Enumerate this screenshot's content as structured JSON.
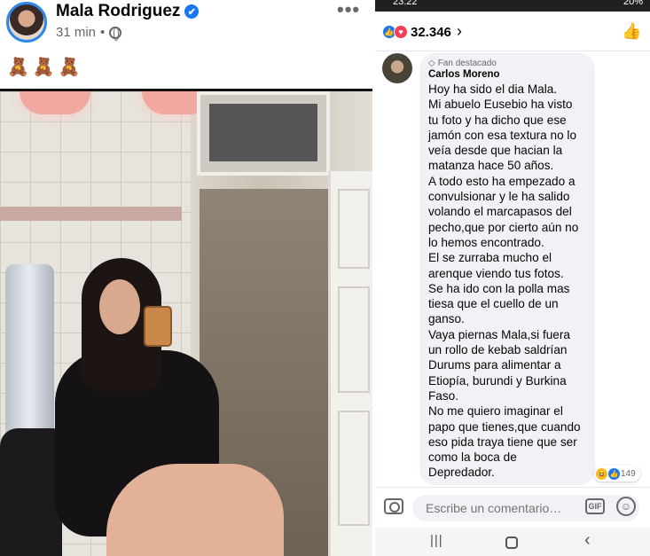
{
  "post": {
    "author": "Mala Rodriguez",
    "time": "31 min",
    "separator": "•",
    "more_label": "•••",
    "emojis": [
      "🧸",
      "🧸",
      "🧸"
    ],
    "verified_glyph": "✔"
  },
  "status_bar": {
    "time": "23:22",
    "battery": "20%"
  },
  "reactions": {
    "count": "32.346",
    "chevron": "›",
    "like_glyph": "👍",
    "love_glyph": "♥",
    "thumb_button_glyph": "👍"
  },
  "comment": {
    "badge": "Fan destacado",
    "badge_icon": "◇",
    "author": "Carlos Moreno",
    "text": "Hoy ha sido el dia Mala.\nMi abuelo Eusebio ha visto\ntu foto y ha dicho que ese\njamón con esa textura no lo\nveía desde que hacian la\nmatanza hace 50 años.\nA todo esto ha empezado a\nconvulsionar y le ha salido\nvolando el marcapasos del\npecho,que por cierto aún no\nlo hemos encontrado.\nEl se zurraba mucho el\narenque viendo tus fotos.\nSe ha ido con la polla mas\ntiesa que el cuello de un\nganso.\nVaya piernas Mala,si fuera\nun rollo de kebab saldrían\nDurums para alimentar a\nEtiopía, burundi y Burkina\nFaso.\nNo me quiero imaginar el\npapo que tienes,que  cuando\neso pida traya tiene que ser\ncomo la boca de\nDepredador.",
    "reaction_count": "149",
    "reaction_glyphs": [
      "😆",
      "👍"
    ]
  },
  "composer": {
    "placeholder": "Escribe un comentario…",
    "gif_label": "GIF",
    "emoji_glyph": "☺"
  },
  "navbar": {
    "recents": "|||",
    "back": "‹"
  }
}
